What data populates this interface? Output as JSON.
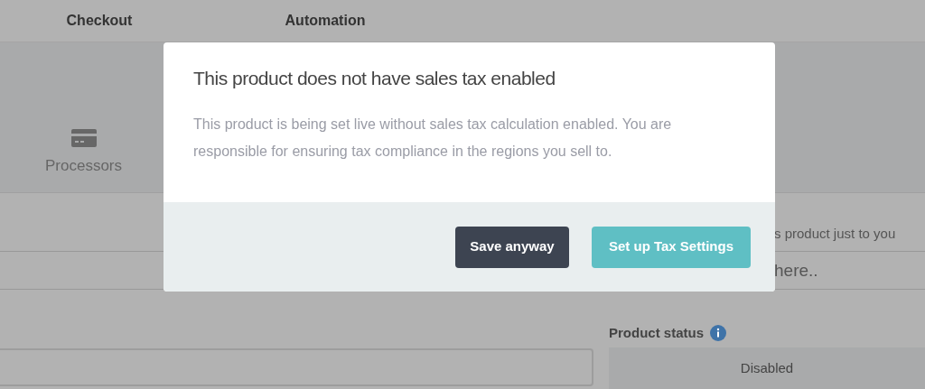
{
  "nav_tabs": [
    {
      "label": "Checkout"
    },
    {
      "label": "Automation"
    }
  ],
  "section_tabs": [
    {
      "label": "Processors"
    }
  ],
  "form": {
    "hint": "s product just to you",
    "text_field": {
      "placeholder": "here.."
    },
    "status": {
      "label": "Product status",
      "value": "Disabled"
    }
  },
  "dialog": {
    "title": "This product does not have sales tax enabled",
    "message": "This product is being set live without sales tax calculation enabled. You are responsible for ensuring tax compliance in the regions you sell to.",
    "buttons": [
      {
        "label": "Save anyway",
        "kind": "secondary"
      },
      {
        "label": "Set up Tax Settings",
        "kind": "primary"
      }
    ]
  }
}
